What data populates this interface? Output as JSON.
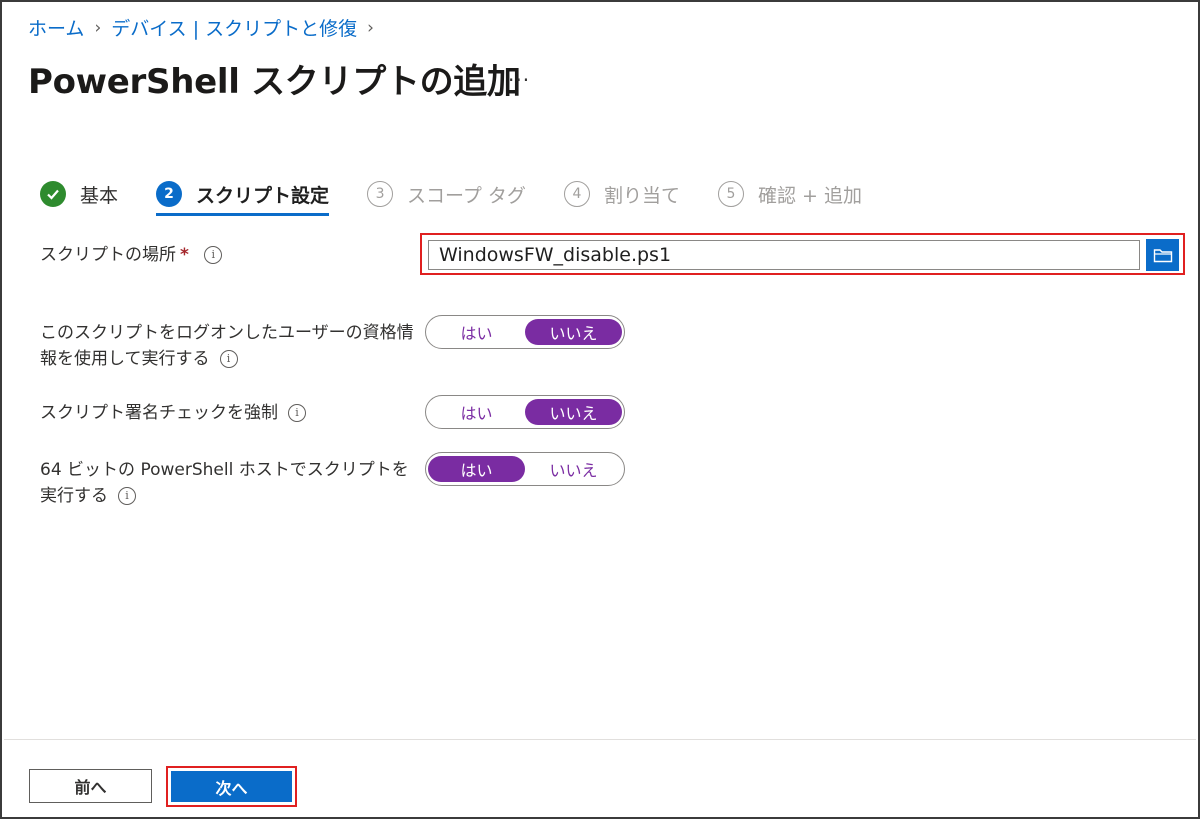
{
  "breadcrumb": [
    {
      "label": "ホーム"
    },
    {
      "label": "デバイス | スクリプトと修復"
    }
  ],
  "page_title": "PowerShell スクリプトの追加",
  "more_label": "...",
  "steps": [
    {
      "num": "✓",
      "label": "基本",
      "state": "done"
    },
    {
      "num": "2",
      "label": "スクリプト設定",
      "state": "active"
    },
    {
      "num": "3",
      "label": "スコープ タグ",
      "state": "pending"
    },
    {
      "num": "4",
      "label": "割り当て",
      "state": "pending"
    },
    {
      "num": "5",
      "label": "確認 + 追加",
      "state": "pending"
    }
  ],
  "script_location": {
    "label": "スクリプトの場所",
    "required_mark": "*",
    "value": "WindowsFW_disable.ps1"
  },
  "settings": [
    {
      "label_line1": "このスクリプトをログオンしたユーザーの資格情",
      "label_line2": "報を使用して実行する",
      "yes": "はい",
      "no": "いいえ",
      "selected": "no"
    },
    {
      "label_line1": "スクリプト署名チェックを強制",
      "label_line2": "",
      "yes": "はい",
      "no": "いいえ",
      "selected": "no"
    },
    {
      "label_line1": "64 ビットの PowerShell ホストでスクリプトを",
      "label_line2": "実行する",
      "yes": "はい",
      "no": "いいえ",
      "selected": "yes"
    }
  ],
  "footer": {
    "prev_label": "前へ",
    "next_label": "次へ"
  },
  "colors": {
    "accent": "#0a6cc9",
    "toggle_selected": "#7a2ca2",
    "highlight_border": "#e02020",
    "done_green": "#2e8b2e"
  }
}
